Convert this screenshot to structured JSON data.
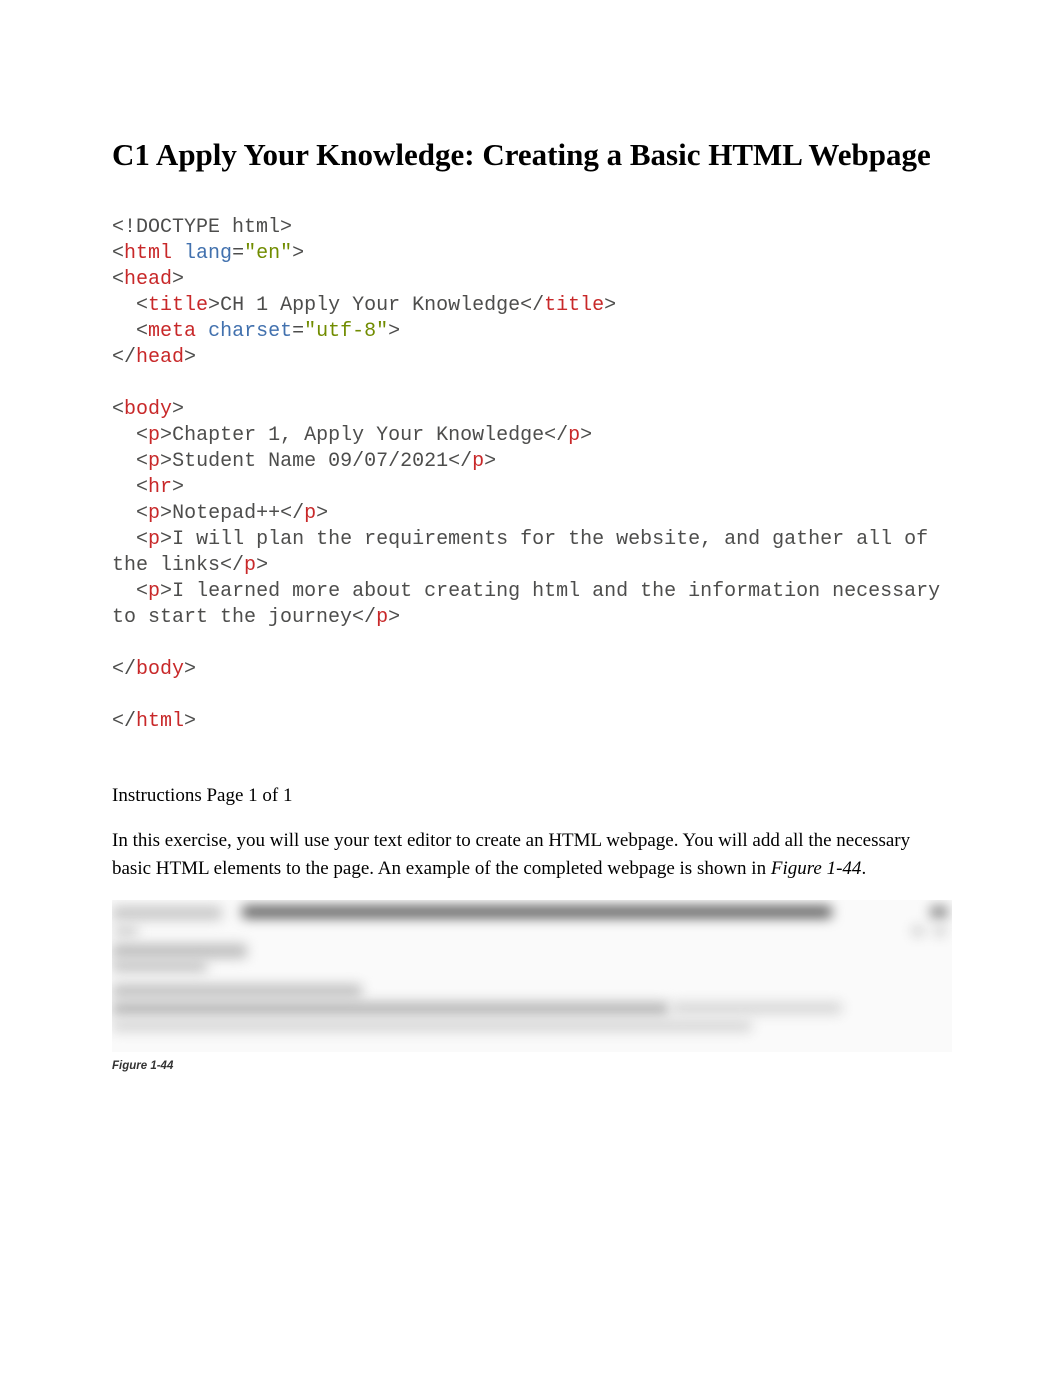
{
  "heading": "C1 Apply Your Knowledge: Creating a Basic HTML Webpage",
  "code": {
    "l1_doctype": "<!DOCTYPE html>",
    "l2_open": "<",
    "l2_tag": "html",
    "l2_sp": " ",
    "l2_attr": "lang",
    "l2_eq": "=",
    "l2_val": "\"en\"",
    "l2_close": ">",
    "l3_open": "<",
    "l3_tag": "head",
    "l3_close": ">",
    "l4_indent": "  ",
    "l4_open": "<",
    "l4_tag": "title",
    "l4_close1": ">",
    "l4_text": "CH 1 Apply Your Knowledge",
    "l4_open2": "</",
    "l4_tag2": "title",
    "l4_close2": ">",
    "l5_indent": "  ",
    "l5_open": "<",
    "l5_tag": "meta",
    "l5_sp": " ",
    "l5_attr": "charset",
    "l5_eq": "=",
    "l5_val": "\"utf-8\"",
    "l5_close": ">",
    "l6_open": "</",
    "l6_tag": "head",
    "l6_close": ">",
    "l8_open": "<",
    "l8_tag": "body",
    "l8_close": ">",
    "l9_indent": "  ",
    "l9_open": "<",
    "l9_tag": "p",
    "l9_close1": ">",
    "l9_text": "Chapter 1, Apply Your Knowledge",
    "l9_open2": "</",
    "l9_tag2": "p",
    "l9_close2": ">",
    "l10_indent": "  ",
    "l10_open": "<",
    "l10_tag": "p",
    "l10_close1": ">",
    "l10_text": "Student Name 09/07/2021",
    "l10_open2": "</",
    "l10_tag2": "p",
    "l10_close2": ">",
    "l11_indent": "  ",
    "l11_open": "<",
    "l11_tag": "hr",
    "l11_close": ">",
    "l12_indent": "  ",
    "l12_open": "<",
    "l12_tag": "p",
    "l12_close1": ">",
    "l12_text": "Notepad++",
    "l12_open2": "</",
    "l12_tag2": "p",
    "l12_close2": ">",
    "l13_indent": "  ",
    "l13_open": "<",
    "l13_tag": "p",
    "l13_close1": ">",
    "l13_text": "I will plan the requirements for the website, and gather all of the links",
    "l13_open2": "</",
    "l13_tag2": "p",
    "l13_close2": ">",
    "l14_indent": "  ",
    "l14_open": "<",
    "l14_tag": "p",
    "l14_close1": ">",
    "l14_text": "I learned more about creating html and the information necessary to start the journey",
    "l14_open2": "</",
    "l14_tag2": "p",
    "l14_close2": ">",
    "l16_open": "</",
    "l16_tag": "body",
    "l16_close": ">",
    "l18_open": "</",
    "l18_tag": "html",
    "l18_close": ">"
  },
  "instructions_label": "Instructions Page 1 of 1",
  "instructions_text_1": "In this exercise, you will use your text editor to create an HTML webpage. You will add all the necessary basic HTML elements to the page. An example of the completed webpage is shown in ",
  "instructions_text_em": "Figure 1-44",
  "instructions_text_2": ".",
  "figure_caption": "Figure 1-44"
}
